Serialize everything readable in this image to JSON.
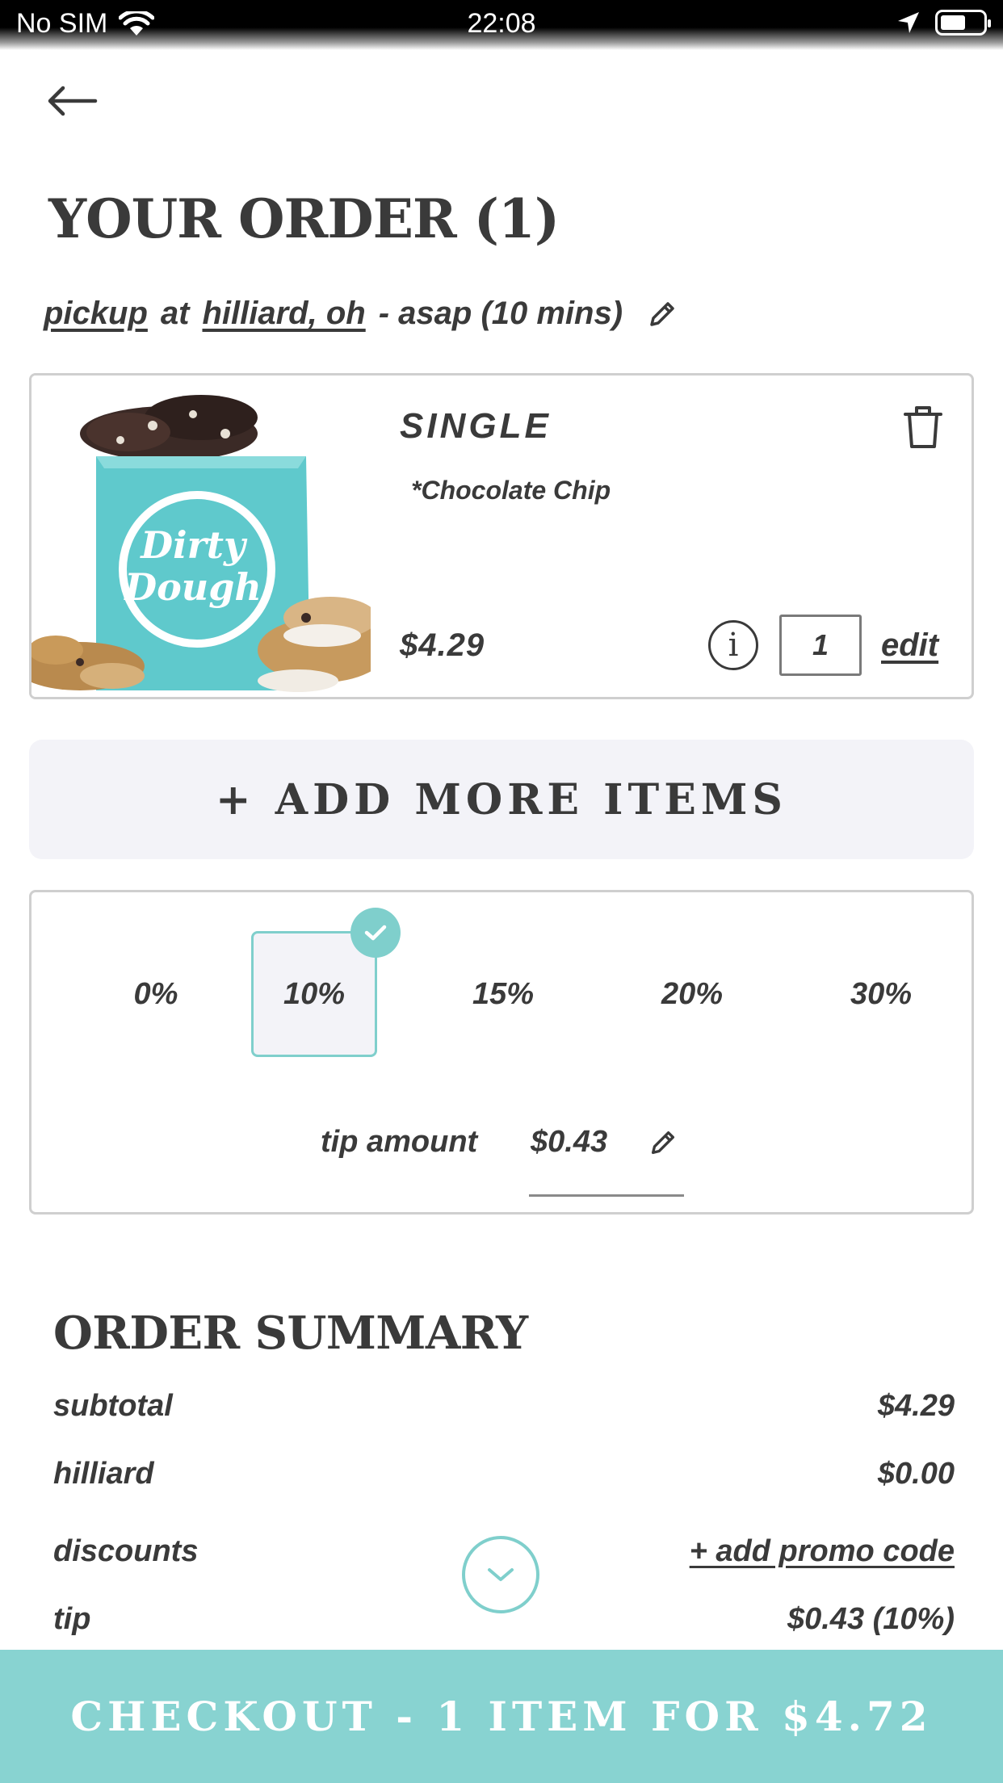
{
  "status_bar": {
    "carrier": "No SIM",
    "time": "22:08"
  },
  "header": {
    "title": "YOUR ORDER (1)"
  },
  "pickup": {
    "mode": "pickup",
    "at": "at",
    "location": "hilliard, oh",
    "timing": "- asap (10 mins)"
  },
  "cart": {
    "items": [
      {
        "name": "SINGLE",
        "option": "*Chocolate Chip",
        "price": "$4.29",
        "quantity": "1",
        "edit_label": "edit",
        "photo_brand": "Dirty Dough"
      }
    ]
  },
  "add_more_label": "+ ADD MORE ITEMS",
  "tip": {
    "options": [
      "0%",
      "10%",
      "15%",
      "20%",
      "30%"
    ],
    "selected": "10%",
    "amount_label": "tip amount",
    "amount_value": "$0.43"
  },
  "summary": {
    "title": "ORDER SUMMARY",
    "rows": [
      {
        "label": "subtotal",
        "value": "$4.29"
      },
      {
        "label": "hilliard",
        "value": "$0.00"
      },
      {
        "label": "discounts",
        "value": "+ add promo code"
      },
      {
        "label": "tip",
        "value": "$0.43 (10%)"
      }
    ]
  },
  "checkout_label": "CHECKOUT - 1 ITEM FOR $4.72",
  "colors": {
    "accent": "#88d3d1",
    "accent_border": "#7fcfcc",
    "text": "#3a3a3a",
    "panel": "#f3f3f8",
    "box_teal": "#5fc9cc"
  }
}
